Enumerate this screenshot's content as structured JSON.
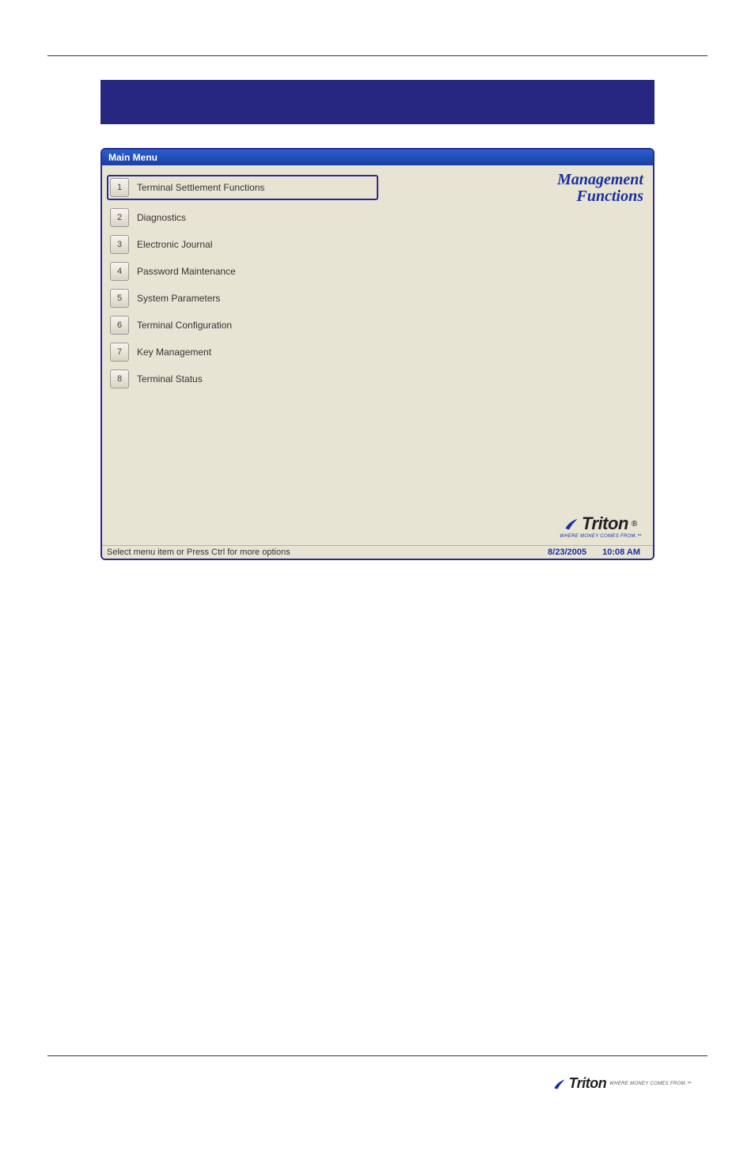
{
  "window": {
    "title": "Main Menu",
    "right_panel_title_line1": "Management",
    "right_panel_title_line2": "Functions",
    "menu_items": [
      {
        "num": "1",
        "label": "Terminal Settlement Functions",
        "highlighted": true
      },
      {
        "num": "2",
        "label": "Diagnostics",
        "highlighted": false
      },
      {
        "num": "3",
        "label": "Electronic Journal",
        "highlighted": false
      },
      {
        "num": "4",
        "label": "Password Maintenance",
        "highlighted": false
      },
      {
        "num": "5",
        "label": "System Parameters",
        "highlighted": false
      },
      {
        "num": "6",
        "label": "Terminal Configuration",
        "highlighted": false
      },
      {
        "num": "7",
        "label": "Key Management",
        "highlighted": false
      },
      {
        "num": "8",
        "label": "Terminal Status",
        "highlighted": false
      }
    ],
    "status_hint": "Select menu item or Press Ctrl for more options",
    "status_date": "8/23/2005",
    "status_time": "10:08 AM"
  },
  "brand": {
    "name": "Triton",
    "tagline": "WHERE MONEY COMES FROM.™"
  }
}
